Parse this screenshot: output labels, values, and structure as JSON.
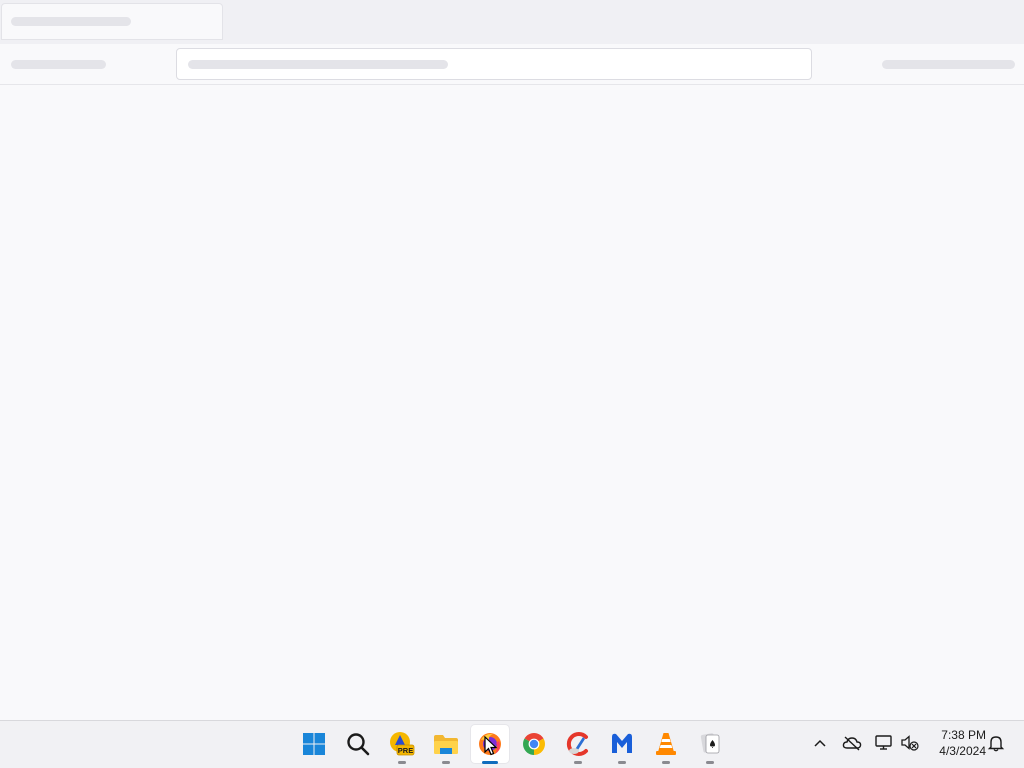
{
  "browser": {
    "state": "loading-skeleton",
    "tabs": [
      {
        "title": ""
      }
    ],
    "address_bar": {
      "value": ""
    }
  },
  "taskbar": {
    "apps": [
      {
        "name": "start-button-icon",
        "label": ""
      },
      {
        "name": "search-icon",
        "label": ""
      },
      {
        "name": "app-pre-icon",
        "label": "PRE",
        "running": true
      },
      {
        "name": "file-explorer-icon",
        "label": "",
        "running": true
      },
      {
        "name": "firefox-icon",
        "label": "",
        "running": true,
        "active": true
      },
      {
        "name": "chrome-icon",
        "label": "",
        "running": false
      },
      {
        "name": "ccleaner-icon",
        "label": "",
        "running": true
      },
      {
        "name": "malwarebytes-icon",
        "label": "",
        "running": true
      },
      {
        "name": "vlc-icon",
        "label": "",
        "running": true
      },
      {
        "name": "solitaire-icon",
        "label": "",
        "running": true
      }
    ],
    "tray": {
      "icons": [
        "chevron-up-icon",
        "onedrive-offline-icon",
        "network-icon",
        "speaker-muted-icon"
      ],
      "time": "7:38 PM",
      "date": "4/3/2024",
      "notification_icon": "bell-icon"
    }
  },
  "colors": {
    "accent": "#0f6cbd",
    "background": "#f9f9fb",
    "skeleton": "#e4e4e9"
  }
}
